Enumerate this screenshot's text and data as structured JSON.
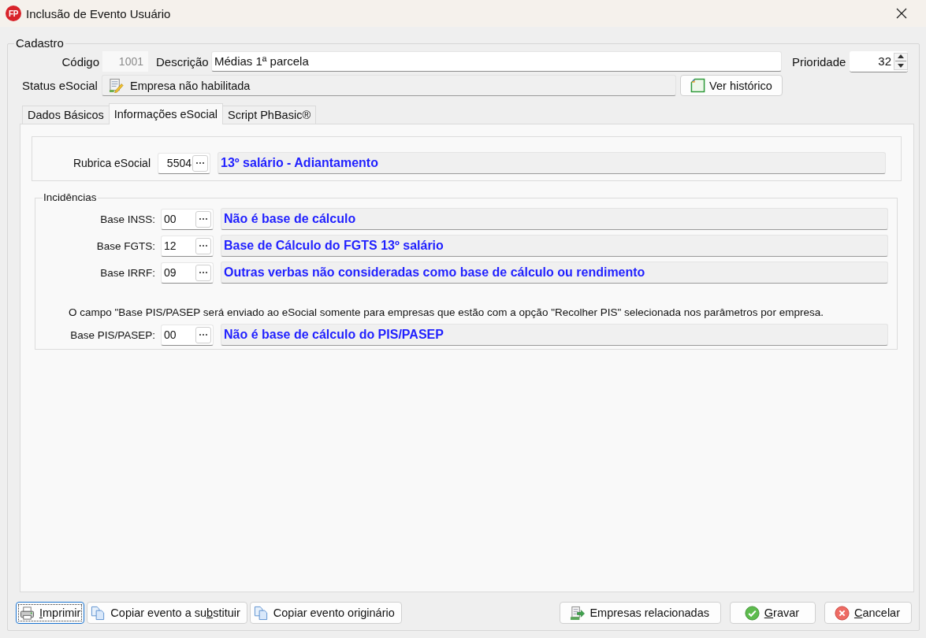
{
  "window": {
    "logo": "FP",
    "title": "Inclusão de Evento Usuário"
  },
  "cadastro": {
    "title": "Cadastro",
    "codigo": {
      "label": "Código",
      "value": "1001",
      "disabled": true
    },
    "descricao": {
      "label": "Descrição",
      "value": "Médias 1ª parcela"
    },
    "prioridade": {
      "label": "Prioridade",
      "value": "32"
    },
    "status_esocial": {
      "label": "Status eSocial",
      "value": "Empresa não habilitada"
    },
    "history_button": {
      "label": "Ver histórico"
    }
  },
  "tabs": [
    {
      "label": "Dados Básicos",
      "selected": false
    },
    {
      "label": "Informações eSocial",
      "selected": true
    },
    {
      "label": "Script PhBasic®",
      "selected": false
    }
  ],
  "rubrica": {
    "label": "Rubrica eSocial",
    "code": "5504",
    "description": "13º salário - Adiantamento"
  },
  "incidencias": {
    "title": "Incidências",
    "rows": [
      {
        "label": "Base INSS:",
        "code": "00",
        "description": "Não é base de cálculo"
      },
      {
        "label": "Base FGTS:",
        "code": "12",
        "description": "Base de Cálculo do FGTS 13º salário"
      },
      {
        "label": "Base IRRF:",
        "code": "09",
        "description": "Outras verbas não consideradas como base de cálculo ou rendimento"
      }
    ],
    "note": "O campo \"Base PIS/PASEP será enviado ao eSocial somente para empresas que estão com a opção \"Recolher PIS\" selecionada nos parâmetros por empresa.",
    "pis_row": {
      "label": "Base PIS/PASEP:",
      "code": "00",
      "description": "Não é base de cálculo do PIS/PASEP"
    }
  },
  "footer": {
    "left_buttons": [
      {
        "kind": "print",
        "access_key": "I",
        "text_after": "mprimir",
        "focused": true
      },
      {
        "kind": "copy",
        "text_before": "Copiar evento a su",
        "access_key": "b",
        "text_after": "stituir",
        "focused": false
      },
      {
        "kind": "copy",
        "label": "Copiar evento originário",
        "focused": false
      }
    ],
    "right_buttons": [
      {
        "kind": "companies",
        "label": "Empresas relacionadas",
        "focused": false
      },
      {
        "kind": "save",
        "access_key": "G",
        "text_after": "ravar",
        "focused": false
      },
      {
        "kind": "cancel",
        "access_key": "C",
        "text_after": "ancelar",
        "focused": false
      }
    ]
  }
}
